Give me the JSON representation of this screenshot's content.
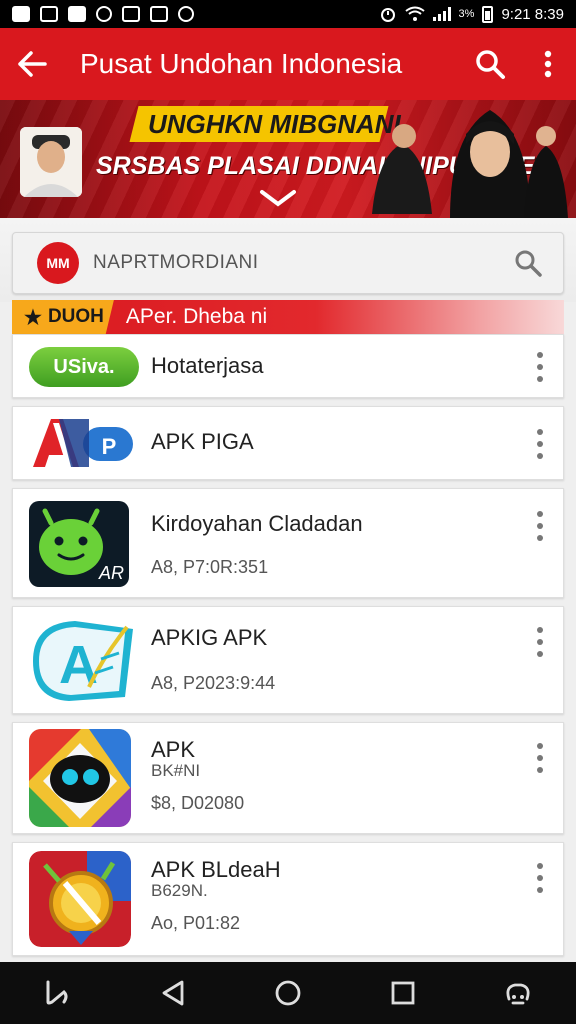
{
  "status_bar": {
    "time": "9:21 8:39",
    "battery_text": "3%",
    "left_icons": [
      "notification-icon",
      "image-icon",
      "photo-icon",
      "bag-icon",
      "edit-icon",
      "sync-icon"
    ]
  },
  "app_bar": {
    "title": "Pusat Undohan Indonesia",
    "back_icon": "arrow-left-icon",
    "search_icon": "search-icon",
    "more_icon": "more-vert-icon",
    "color": "#d9181e"
  },
  "banner": {
    "line1": "UNGHKN MIBGNANI",
    "line2": "SRSBAS PLASAI DDNALI NIPUNAVE"
  },
  "search": {
    "logo_text": "MM",
    "text": "NAPRTMORDIANI"
  },
  "section": {
    "tag": "DUOH",
    "title": "APer. Dheba ni"
  },
  "apps": [
    {
      "name": "Hotaterjasa",
      "sub": "",
      "meta": "",
      "icon": "usiva-icon",
      "icon_label": "USiva."
    },
    {
      "name": "APK PIGA",
      "sub": "",
      "meta": "",
      "icon": "ap-logo-icon",
      "icon_label": "AP"
    },
    {
      "name": "Kirdoyahan Cladadan",
      "sub": "",
      "meta": "A8, P7:0R:351",
      "icon": "android-icon",
      "icon_label": "AR"
    },
    {
      "name": "APKIG APK",
      "sub": "",
      "meta": "A8, P2023:9:44",
      "icon": "a-feather-icon",
      "icon_label": "A"
    },
    {
      "name": "APK",
      "sub": "BK#NI",
      "meta": "$8, D02080",
      "icon": "robot-face-icon",
      "icon_label": ""
    },
    {
      "name": "APK BLdeaH",
      "sub": "B629N.",
      "meta": "Ao, P01:82",
      "icon": "medal-icon",
      "icon_label": ""
    }
  ],
  "nav_bar": {
    "buttons": [
      "recents-alt-icon",
      "back-triangle-icon",
      "home-circle-icon",
      "overview-square-icon",
      "assist-icon"
    ]
  }
}
